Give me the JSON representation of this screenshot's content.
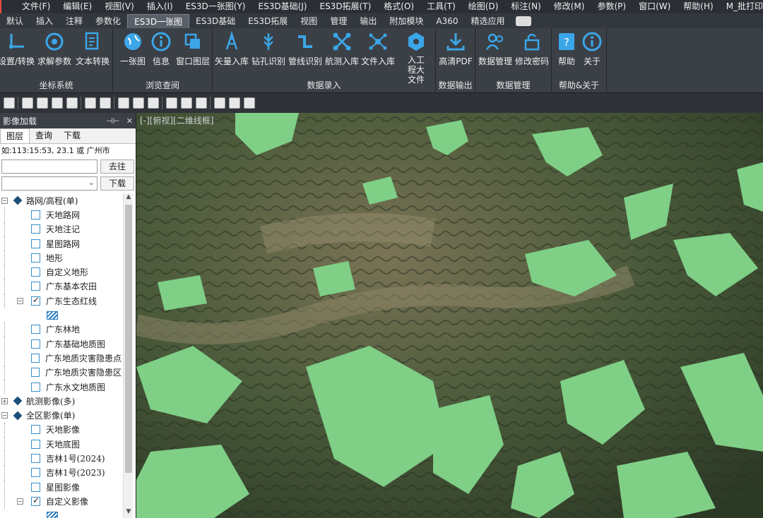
{
  "menubar": {
    "items": [
      "文件(F)",
      "编辑(E)",
      "视图(V)",
      "插入(I)",
      "ES3D一张图(Y)",
      "ES3D基础(J)",
      "ES3D拓展(T)",
      "格式(O)",
      "工具(T)",
      "绘图(D)",
      "标注(N)",
      "修改(M)",
      "参数(P)",
      "窗口(W)",
      "帮助(H)",
      "M_批打印"
    ]
  },
  "tabs": {
    "items": [
      "默认",
      "插入",
      "注释",
      "参数化",
      "ES3D一张图",
      "ES3D基础",
      "ES3D拓展",
      "视图",
      "管理",
      "输出",
      "附加模块",
      "A360",
      "精选应用"
    ],
    "active": "ES3D一张图"
  },
  "ribbon": {
    "groups": [
      {
        "label": "坐标系统",
        "buttons": [
          "设置/转换",
          "求解参数",
          "文本转换"
        ]
      },
      {
        "label": "浏览查阅",
        "buttons": [
          "一张图",
          "信息",
          "窗口图层"
        ]
      },
      {
        "label": "数据录入",
        "buttons": [
          "矢量入库",
          "钻孔识别",
          "管线识别",
          "航测入库",
          "文件入库",
          "入工程大文件"
        ]
      },
      {
        "label": "数据输出",
        "buttons": [
          "高清PDF"
        ]
      },
      {
        "label": "数据管理",
        "buttons": [
          "数据管理",
          "修改密码"
        ]
      },
      {
        "label": "帮助&关于",
        "buttons": [
          "帮助",
          "关于"
        ]
      }
    ],
    "accent": "#3ba6e8"
  },
  "panel": {
    "title": "影像加载",
    "pin_icon": "pin-icon",
    "close_icon": "close-icon",
    "tabs": [
      "图层",
      "查询",
      "下载"
    ],
    "hint": "如:113:15:53, 23.1 或 广州市",
    "go_button": "去往",
    "download_button": "下载",
    "tree": [
      {
        "type": "group",
        "label": "路网/高程(单)",
        "expanded": true
      },
      {
        "type": "item",
        "label": "天地路网",
        "checked": false
      },
      {
        "type": "item",
        "label": "天地注记",
        "checked": false
      },
      {
        "type": "item",
        "label": "星图路网",
        "checked": false
      },
      {
        "type": "item",
        "label": "地形",
        "checked": false
      },
      {
        "type": "item",
        "label": "自定义地形",
        "checked": false
      },
      {
        "type": "item",
        "label": "广东基本农田",
        "checked": false
      },
      {
        "type": "item",
        "label": "广东生态红线",
        "checked": true,
        "expanded": true
      },
      {
        "type": "legend",
        "label": ""
      },
      {
        "type": "item",
        "label": "广东林地",
        "checked": false
      },
      {
        "type": "item",
        "label": "广东基础地质图",
        "checked": false
      },
      {
        "type": "item",
        "label": "广东地质灾害隐患点",
        "checked": false
      },
      {
        "type": "item",
        "label": "广东地质灾害隐患区",
        "checked": false
      },
      {
        "type": "item",
        "label": "广东水文地质图",
        "checked": false
      },
      {
        "type": "group",
        "label": "航测影像(多)",
        "expanded": false
      },
      {
        "type": "group",
        "label": "全区影像(单)",
        "expanded": true
      },
      {
        "type": "item",
        "label": "天地影像",
        "checked": false
      },
      {
        "type": "item",
        "label": "天地底图",
        "checked": false
      },
      {
        "type": "item",
        "label": "吉林1号(2024)",
        "checked": false
      },
      {
        "type": "item",
        "label": "吉林1号(2023)",
        "checked": false
      },
      {
        "type": "item",
        "label": "星图影像",
        "checked": false
      },
      {
        "type": "item",
        "label": "自定义影像",
        "checked": true,
        "expanded": true
      },
      {
        "type": "legend",
        "label": ""
      }
    ]
  },
  "map": {
    "view_label": "[-][俯视][二维线框]",
    "overlay_color": "#7fcf86"
  }
}
